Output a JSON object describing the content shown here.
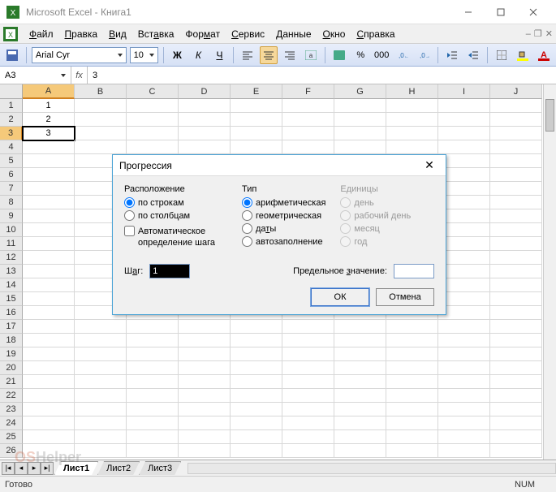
{
  "titlebar": {
    "title": "Microsoft Excel - Книга1"
  },
  "menu": {
    "items": [
      "Файл",
      "Правка",
      "Вид",
      "Вставка",
      "Формат",
      "Сервис",
      "Данные",
      "Окно",
      "Справка"
    ]
  },
  "toolbar": {
    "font_name": "Arial Cyr",
    "font_size": "10"
  },
  "formulabar": {
    "cell_ref": "A3",
    "value": "3"
  },
  "grid": {
    "columns": [
      "A",
      "B",
      "C",
      "D",
      "E",
      "F",
      "G",
      "H",
      "I",
      "J"
    ],
    "selected_col": "A",
    "selected_row": 3,
    "rows": 26,
    "data": {
      "A1": "1",
      "A2": "2",
      "A3": "3"
    }
  },
  "sheets": {
    "active": "Лист1",
    "tabs": [
      "Лист1",
      "Лист2",
      "Лист3"
    ]
  },
  "statusbar": {
    "ready": "Готово",
    "num": "NUM"
  },
  "dialog": {
    "title": "Прогрессия",
    "group_layout": {
      "title": "Расположение",
      "opt_rows": "по строкам",
      "opt_cols": "по столбцам"
    },
    "group_type": {
      "title": "Тип",
      "opt_arith": "арифметическая",
      "opt_geom": "геометрическая",
      "opt_dates": "даты",
      "opt_autofill": "автозаполнение"
    },
    "group_units": {
      "title": "Единицы",
      "opt_day": "день",
      "opt_workday": "рабочий день",
      "opt_month": "месяц",
      "opt_year": "год"
    },
    "auto_step": "Автоматическое определение шага",
    "step_label": "Шаг:",
    "step_value": "1",
    "limit_label": "Предельное значение:",
    "limit_value": "",
    "ok": "ОК",
    "cancel": "Отмена"
  },
  "watermark": {
    "a": "OS",
    "b": "Helper"
  }
}
